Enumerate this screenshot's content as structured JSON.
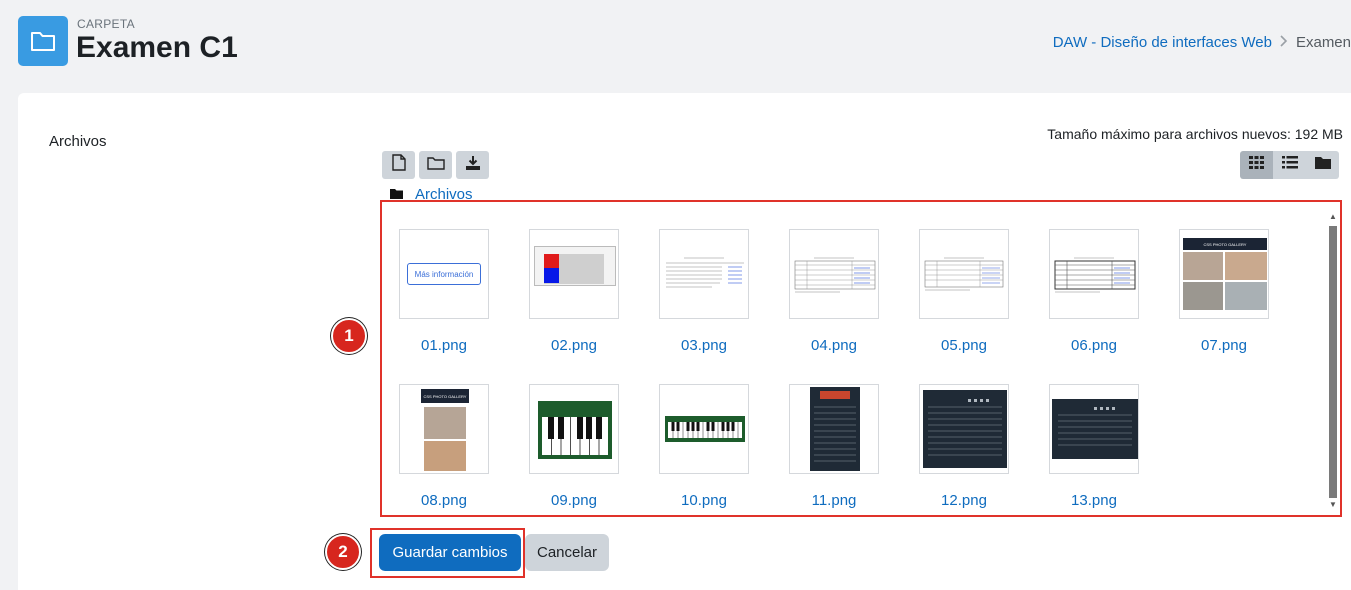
{
  "header": {
    "eyebrow": "CARPETA",
    "title": "Examen C1",
    "icon": "folder-icon"
  },
  "breadcrumb": {
    "course": "DAW - Diseño de interfaces Web",
    "current": "Examen"
  },
  "form": {
    "field_label": "Archivos",
    "max_size": "Tamaño máximo para archivos nuevos: 192 MB"
  },
  "filepicker": {
    "toolbar": [
      "add-file-icon",
      "create-folder-icon",
      "download-icon"
    ],
    "views": [
      "grid-view-icon",
      "list-view-icon",
      "tree-view-icon"
    ],
    "path_label": "Archivos",
    "files": [
      {
        "name": "01.png"
      },
      {
        "name": "02.png"
      },
      {
        "name": "03.png"
      },
      {
        "name": "04.png"
      },
      {
        "name": "05.png"
      },
      {
        "name": "06.png"
      },
      {
        "name": "07.png"
      },
      {
        "name": "08.png"
      },
      {
        "name": "09.png"
      },
      {
        "name": "10.png"
      },
      {
        "name": "11.png"
      },
      {
        "name": "12.png"
      },
      {
        "name": "13.png"
      }
    ],
    "thumb_text": {
      "mas_info": "Más información",
      "gallery": "CSS PHOTO GALLERY"
    }
  },
  "actions": {
    "save": "Guardar cambios",
    "cancel": "Cancelar"
  },
  "annotations": {
    "badge1": "1",
    "badge2": "2"
  },
  "colors": {
    "accent": "#0f6cbf",
    "highlight": "#e0322a",
    "folder_icon_bg": "#399be2"
  }
}
